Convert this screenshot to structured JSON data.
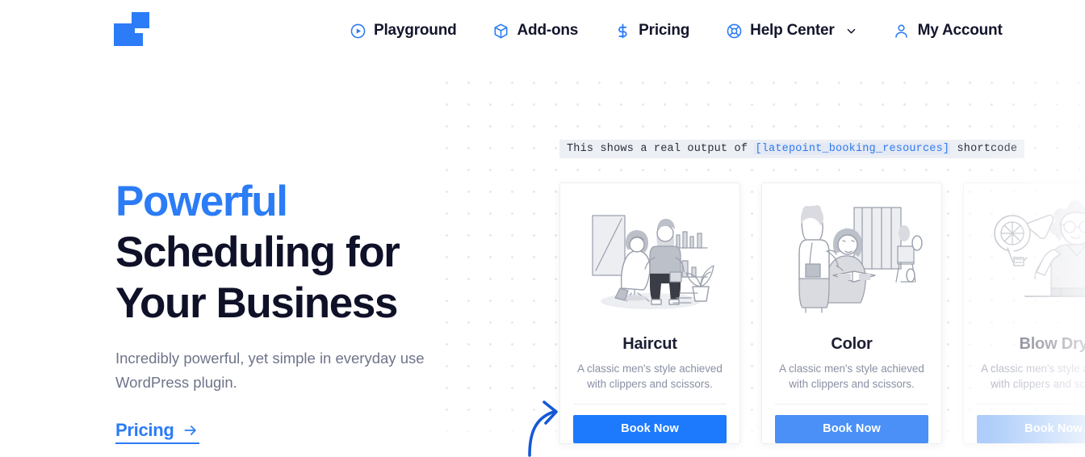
{
  "brand": {
    "logo_name": "latepoint-logo",
    "accent_color": "#2b7cf6",
    "button_color": "#1d7afc",
    "heading_color": "#0f1128",
    "muted_color": "#6e7489"
  },
  "header": {
    "nav": [
      {
        "label": "Playground",
        "icon": "play-circle-icon",
        "has_caret": false
      },
      {
        "label": "Add-ons",
        "icon": "cube-icon",
        "has_caret": false
      },
      {
        "label": "Pricing",
        "icon": "dollar-icon",
        "has_caret": false
      },
      {
        "label": "Help Center",
        "icon": "lifebuoy-icon",
        "has_caret": true
      },
      {
        "label": "My Account",
        "icon": "user-icon",
        "has_caret": false
      }
    ]
  },
  "hero": {
    "title_line1": "Powerful",
    "title_line2": "Scheduling for",
    "title_line3": "Your Business",
    "subtitle_line1": "Incredibly powerful, yet simple in everyday",
    "subtitle_line2": "use WordPress plugin.",
    "cta_label": "Pricing",
    "cta_icon": "arrow-right-icon"
  },
  "shortcode_banner": {
    "prefix": "This shows a real output of ",
    "code": "[latepoint_booking_resources]",
    "suffix": " shortcode"
  },
  "annotation": {
    "arrow_icon": "curved-arrow-icon",
    "points_to": "Book Now"
  },
  "cards": [
    {
      "title": "Haircut",
      "description": "A classic men's style achieved with clippers and scissors.",
      "button_label": "Book Now",
      "illustration": "barber-cutting-hair-illustration",
      "button_color": "#1d7afc",
      "state": "active"
    },
    {
      "title": "Color",
      "description": "A classic men's style achieved with clippers and scissors.",
      "button_label": "Book Now",
      "illustration": "hair-coloring-salon-illustration",
      "button_color": "#4a90f7",
      "state": "active"
    },
    {
      "title": "Blow Dry",
      "description": "A classic men's style achieved with clippers and scissors.",
      "button_label": "Book Now",
      "illustration": "blow-dryer-stylist-illustration",
      "button_color": "#7eb0f7",
      "state": "faded-cut-off"
    }
  ]
}
